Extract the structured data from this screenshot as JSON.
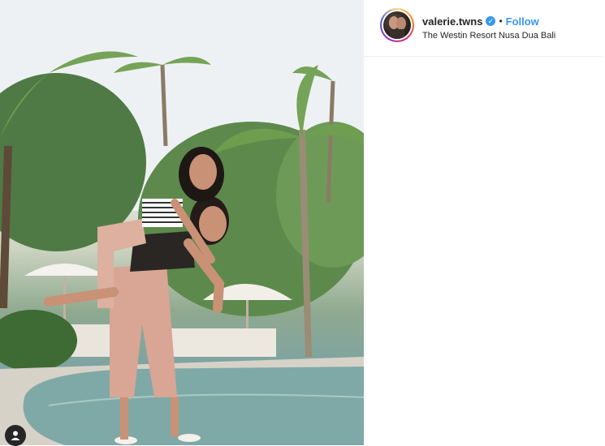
{
  "post": {
    "username": "valerie.twns",
    "separator": "•",
    "follow_label": "Follow",
    "location": "The Westin Resort Nusa Dua Bali",
    "verified_glyph": "✓"
  },
  "colors": {
    "accent": "#3897f0",
    "text": "#262626",
    "divider": "#efefef"
  },
  "icons": {
    "verified": "verified-badge-icon",
    "user_tag": "user-tag-icon"
  }
}
